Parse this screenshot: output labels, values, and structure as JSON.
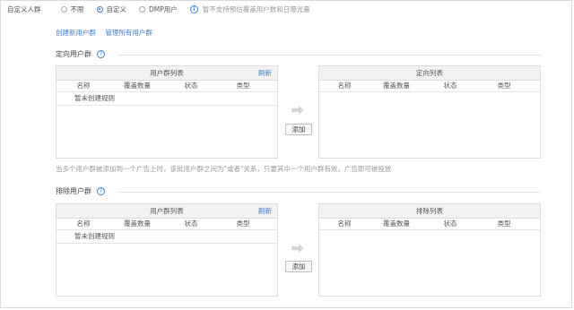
{
  "custom_group": {
    "label": "自定义人群",
    "options": [
      {
        "label": "不限",
        "selected": false
      },
      {
        "label": "自定义",
        "selected": true
      },
      {
        "label": "DMP用户",
        "selected": false
      }
    ],
    "hint": "暂不支持预估覆盖用户数和日曝光量"
  },
  "links": {
    "create": "创建新用户群",
    "manage": "管理所有用户群"
  },
  "targeted": {
    "title": "定向用户群",
    "left_panel": {
      "title": "用户群列表",
      "refresh": "刷新",
      "columns": [
        "名称",
        "覆盖数量",
        "状态",
        "类型"
      ],
      "empty_text": "暂未创建规则"
    },
    "right_panel": {
      "title": "定向列表",
      "columns": [
        "名称",
        "覆盖数量",
        "状态",
        "类型"
      ]
    },
    "add_button": "添加",
    "note": "当多个用户群被添加到一个广告上时，该批用户群之间为\"或者\"关系，只要其中一个用户群有效，广告即可被投放"
  },
  "excluded": {
    "title": "排除用户群",
    "left_panel": {
      "title": "用户群列表",
      "refresh": "刷新",
      "columns": [
        "名称",
        "覆盖数量",
        "状态",
        "类型"
      ],
      "empty_text": "暂未创建规则"
    },
    "right_panel": {
      "title": "排除列表",
      "columns": [
        "名称",
        "覆盖数量",
        "状态",
        "类型"
      ]
    },
    "add_button": "添加"
  },
  "colors": {
    "accent": "#3a7fd0",
    "panel_header": "#f2f2f2",
    "border": "#dcdcdc"
  }
}
